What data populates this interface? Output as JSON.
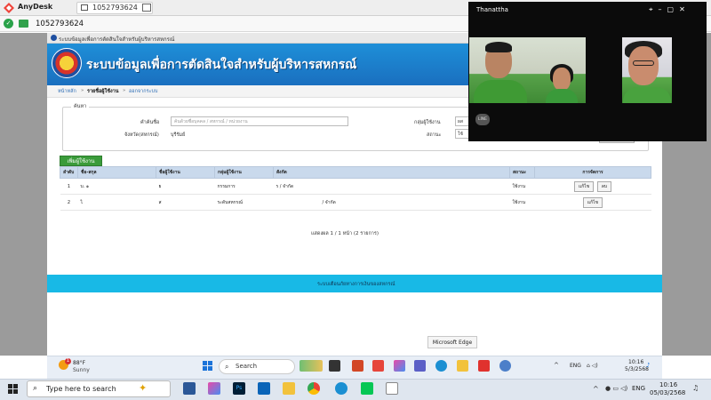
{
  "anydesk": {
    "app_name": "AnyDesk",
    "session_tab": "1052793624",
    "address": "1052793624"
  },
  "browser": {
    "tab_title": "ระบบข้อมูลเพื่อการตัดสินใจสำหรับผู้บริหารสหกรณ์"
  },
  "site": {
    "title": "ระบบข้อมูลเพื่อการตัดสินใจสำหรับผู้บริหารสหกรณ์",
    "breadcrumb": {
      "home": "หน้าหลัก",
      "users": "รายชื่อผู้ใช้งาน",
      "logout": "ออกจากระบบ",
      "sep": "»"
    },
    "search": {
      "legend": "ค้นหา",
      "keyword_label": "คำค้นชื่อ",
      "keyword_placeholder": "ค้นด้วยชื่อบุคคล / สหกรณ์ / หน่วยงาน",
      "province_label": "จังหวัด(สหกรณ์)",
      "province_value": "บุรีรัมย์",
      "group_label": "กลุ่มผู้ใช้งาน",
      "group_value": "ผส",
      "status_label": "สถานะ",
      "status_value": "ใช้"
    },
    "add_user_label": "เพิ่มผู้ใช้งาน",
    "table": {
      "headers": [
        "ลำดับ",
        "ชื่อ-สกุล",
        "ชื่อผู้ใช้งาน",
        "กลุ่มผู้ใช้งาน",
        "สังกัด",
        "สถานะ",
        "การจัดการ"
      ],
      "rows": [
        {
          "no": "1",
          "name": "บ.  ๑",
          "username": "ย",
          "group": "กรรมการ",
          "affiliation": "ร                    / จำกัด",
          "status": "ใช้งาน",
          "actions": [
            "แก้ไข",
            "ลบ"
          ]
        },
        {
          "no": "2",
          "name": "ไ",
          "username": "ส",
          "group": "ระดับสหกรณ์",
          "affiliation": "/ จำกัด",
          "status": "ใช้งาน",
          "actions": [
            "แก้ไข"
          ]
        }
      ]
    },
    "pager": "แสดงผล 1 / 1 หน้า (2 รายการ)",
    "footer": "ระบบเตือนภัยทางการเงินของสหกรณ์"
  },
  "tooltip": "Microsoft Edge",
  "remote_taskbar": {
    "weather_badge": "1",
    "temp": "88°F",
    "condition": "Sunny",
    "search_label": "Search",
    "lang": "ENG",
    "time": "10:16",
    "date": "5/3/2568"
  },
  "local_taskbar": {
    "search_label": "Type here to search",
    "lang": "ENG",
    "time": "10:16",
    "date": "05/03/2568"
  },
  "video_call": {
    "caller_name": "Thanattha",
    "app_badge": "LINE"
  },
  "colors": {
    "header_blue": "#1a6fbf",
    "footer_cyan": "#18b9e6",
    "add_green": "#3a9b3a",
    "table_header": "#c9d9ec"
  }
}
